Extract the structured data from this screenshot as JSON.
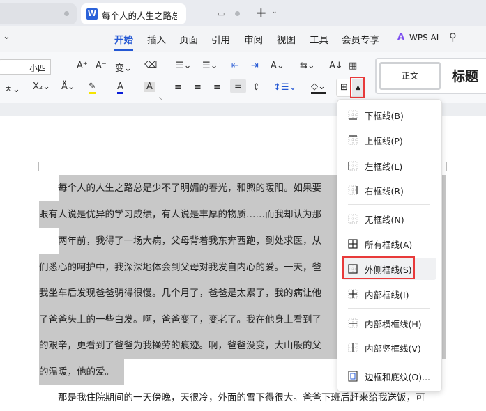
{
  "tabs": {
    "doc_title": "每个人的人生之路总是少不了明",
    "new_tab": "+"
  },
  "menu": {
    "items": [
      "开始",
      "插入",
      "页面",
      "引用",
      "审阅",
      "视图",
      "工具",
      "会员专享"
    ],
    "wps_ai": "WPS AI"
  },
  "ribbon": {
    "font_size": "小四",
    "style_normal": "正文",
    "style_heading": "标题"
  },
  "document": {
    "lines": [
      "　　每个人的人生之路总是少不了明媚的春光，和煦的暖阳。如果要",
      "眼有人说是优异的学习成绩，有人说是丰厚的物质……而我却认为那",
      "　　两年前，我得了一场大病，父母背着我东奔西跑，到处求医，从",
      "们悉心的呵护中，我深深地体会到父母对我发自内心的爱。一天，爸",
      "我坐车后发现爸爸骑得很慢。几个月了，爸爸是太累了，我的病让他",
      "了爸爸头上的一些白发。啊，爸爸变了，变老了。我在他身上看到了",
      "的艰辛，更看到了爸爸为我操劳的痕迹。啊，爸爸没变，大山般的父",
      "的温暖，他的爱。",
      "　　那是我住院期间的一天傍晚，天很冷，外面的雪下得很大。爸爸下班后赶来给我送饭，可"
    ]
  },
  "border_menu": {
    "items": [
      {
        "label": "下框线(B)",
        "icon": "bottom"
      },
      {
        "label": "上框线(P)",
        "icon": "top"
      },
      {
        "label": "左框线(L)",
        "icon": "left"
      },
      {
        "label": "右框线(R)",
        "icon": "right"
      },
      {
        "label": "无框线(N)",
        "icon": "none"
      },
      {
        "label": "所有框线(A)",
        "icon": "all"
      },
      {
        "label": "外侧框线(S)",
        "icon": "outside"
      },
      {
        "label": "内部框线(I)",
        "icon": "inside"
      },
      {
        "label": "内部横框线(H)",
        "icon": "inside-h"
      },
      {
        "label": "内部竖框线(V)",
        "icon": "inside-v"
      },
      {
        "label": "边框和底纹(O)...",
        "icon": "borders-shading"
      }
    ]
  },
  "colors": {
    "accent": "#2458d4",
    "highlight": "#c8c8c8",
    "red": "#e83a3a"
  }
}
